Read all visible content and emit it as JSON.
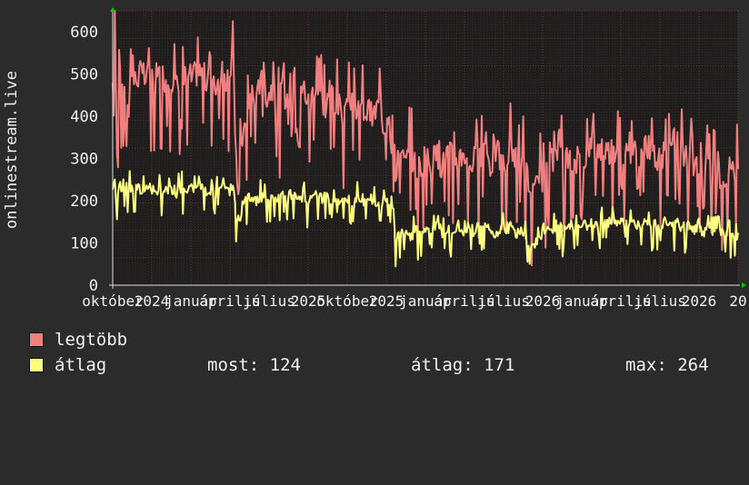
{
  "chart_data": {
    "type": "line",
    "ylabel": "onlinestream.live",
    "ylim": [
      0,
      650
    ],
    "y_ticks": [
      0,
      100,
      200,
      300,
      400,
      500,
      600
    ],
    "grid": true,
    "x_tick_labels": [
      "október",
      "2024",
      "január",
      "április",
      "július",
      "2025",
      "október",
      "2025",
      "január",
      "április",
      "július",
      "2026",
      "január",
      "április",
      "július",
      "2026",
      "20"
    ],
    "series": [
      {
        "name": "legtöbb",
        "color": "#f08080",
        "anchors": [
          [
            0,
            450
          ],
          [
            2,
            600
          ],
          [
            4,
            330
          ],
          [
            6,
            580
          ],
          [
            8,
            480
          ],
          [
            10,
            500
          ],
          [
            13,
            340
          ],
          [
            15,
            500
          ],
          [
            20,
            480
          ],
          [
            25,
            505
          ],
          [
            30,
            490
          ],
          [
            35,
            500
          ],
          [
            40,
            470
          ],
          [
            45,
            505
          ],
          [
            50,
            490
          ],
          [
            55,
            495
          ],
          [
            60,
            470
          ],
          [
            65,
            480
          ],
          [
            70,
            500
          ],
          [
            75,
            490
          ],
          [
            80,
            510
          ],
          [
            85,
            500
          ],
          [
            90,
            480
          ],
          [
            95,
            470
          ],
          [
            100,
            490
          ],
          [
            105,
            500
          ],
          [
            110,
            460
          ],
          [
            113,
            630
          ],
          [
            115,
            330
          ],
          [
            117,
            250
          ],
          [
            119,
            380
          ],
          [
            121,
            350
          ],
          [
            125,
            380
          ],
          [
            130,
            470
          ],
          [
            135,
            420
          ],
          [
            140,
            530
          ],
          [
            145,
            450
          ],
          [
            150,
            470
          ],
          [
            155,
            400
          ],
          [
            160,
            480
          ],
          [
            165,
            410
          ],
          [
            170,
            500
          ],
          [
            175,
            440
          ],
          [
            180,
            470
          ],
          [
            185,
            420
          ],
          [
            190,
            480
          ],
          [
            195,
            460
          ],
          [
            200,
            420
          ],
          [
            205,
            480
          ],
          [
            210,
            430
          ],
          [
            215,
            420
          ],
          [
            220,
            390
          ],
          [
            225,
            460
          ],
          [
            230,
            400
          ],
          [
            235,
            420
          ],
          [
            240,
            410
          ],
          [
            245,
            400
          ],
          [
            250,
            430
          ],
          [
            255,
            380
          ],
          [
            258,
            400
          ],
          [
            262,
            450
          ],
          [
            264,
            360
          ],
          [
            266,
            250
          ],
          [
            268,
            320
          ],
          [
            272,
            300
          ],
          [
            276,
            290
          ],
          [
            280,
            320
          ],
          [
            285,
            280
          ],
          [
            290,
            290
          ],
          [
            295,
            300
          ],
          [
            300,
            290
          ],
          [
            305,
            310
          ],
          [
            310,
            280
          ],
          [
            315,
            320
          ],
          [
            320,
            300
          ],
          [
            325,
            300
          ],
          [
            330,
            320
          ],
          [
            335,
            290
          ],
          [
            340,
            300
          ],
          [
            345,
            290
          ],
          [
            350,
            340
          ],
          [
            355,
            280
          ],
          [
            360,
            320
          ],
          [
            365,
            300
          ],
          [
            370,
            290
          ],
          [
            375,
            330
          ],
          [
            380,
            290
          ],
          [
            385,
            310
          ],
          [
            390,
            260
          ],
          [
            394,
            200
          ],
          [
            398,
            230
          ],
          [
            402,
            250
          ],
          [
            406,
            260
          ],
          [
            410,
            270
          ],
          [
            415,
            300
          ],
          [
            420,
            290
          ],
          [
            425,
            310
          ],
          [
            430,
            290
          ],
          [
            435,
            300
          ],
          [
            440,
            290
          ],
          [
            445,
            310
          ],
          [
            450,
            300
          ],
          [
            455,
            320
          ],
          [
            460,
            330
          ],
          [
            465,
            320
          ],
          [
            470,
            310
          ],
          [
            475,
            350
          ],
          [
            480,
            320
          ],
          [
            485,
            300
          ],
          [
            490,
            330
          ],
          [
            495,
            310
          ],
          [
            500,
            320
          ],
          [
            505,
            330
          ],
          [
            510,
            290
          ],
          [
            515,
            300
          ],
          [
            520,
            310
          ],
          [
            525,
            330
          ],
          [
            530,
            350
          ],
          [
            535,
            320
          ],
          [
            540,
            300
          ],
          [
            545,
            280
          ],
          [
            550,
            300
          ],
          [
            555,
            280
          ],
          [
            560,
            290
          ],
          [
            565,
            270
          ],
          [
            570,
            260
          ],
          [
            575,
            250
          ],
          [
            580,
            270
          ],
          [
            585,
            260
          ],
          [
            588,
            275
          ]
        ]
      },
      {
        "name": "átlag",
        "color": "#ffff80",
        "anchors": [
          [
            0,
            220
          ],
          [
            3,
            210
          ],
          [
            6,
            240
          ],
          [
            10,
            225
          ],
          [
            15,
            235
          ],
          [
            20,
            225
          ],
          [
            25,
            230
          ],
          [
            30,
            220
          ],
          [
            35,
            230
          ],
          [
            40,
            220
          ],
          [
            45,
            230
          ],
          [
            50,
            225
          ],
          [
            55,
            230
          ],
          [
            60,
            220
          ],
          [
            65,
            230
          ],
          [
            70,
            225
          ],
          [
            75,
            235
          ],
          [
            80,
            225
          ],
          [
            85,
            230
          ],
          [
            90,
            220
          ],
          [
            95,
            230
          ],
          [
            100,
            225
          ],
          [
            105,
            230
          ],
          [
            110,
            220
          ],
          [
            113,
            245
          ],
          [
            116,
            165
          ],
          [
            119,
            150
          ],
          [
            122,
            190
          ],
          [
            125,
            200
          ],
          [
            130,
            210
          ],
          [
            135,
            200
          ],
          [
            140,
            210
          ],
          [
            145,
            205
          ],
          [
            150,
            215
          ],
          [
            155,
            200
          ],
          [
            160,
            210
          ],
          [
            165,
            200
          ],
          [
            170,
            215
          ],
          [
            175,
            205
          ],
          [
            180,
            210
          ],
          [
            185,
            200
          ],
          [
            190,
            215
          ],
          [
            195,
            205
          ],
          [
            200,
            210
          ],
          [
            205,
            200
          ],
          [
            210,
            210
          ],
          [
            215,
            200
          ],
          [
            220,
            205
          ],
          [
            225,
            195
          ],
          [
            230,
            205
          ],
          [
            235,
            190
          ],
          [
            240,
            205
          ],
          [
            245,
            195
          ],
          [
            250,
            200
          ],
          [
            255,
            190
          ],
          [
            258,
            200
          ],
          [
            262,
            200
          ],
          [
            264,
            150
          ],
          [
            266,
            110
          ],
          [
            270,
            120
          ],
          [
            275,
            130
          ],
          [
            280,
            115
          ],
          [
            285,
            130
          ],
          [
            290,
            120
          ],
          [
            295,
            140
          ],
          [
            300,
            125
          ],
          [
            305,
            145
          ],
          [
            310,
            125
          ],
          [
            315,
            140
          ],
          [
            320,
            125
          ],
          [
            325,
            145
          ],
          [
            330,
            125
          ],
          [
            335,
            140
          ],
          [
            340,
            125
          ],
          [
            345,
            145
          ],
          [
            350,
            125
          ],
          [
            355,
            135
          ],
          [
            360,
            120
          ],
          [
            365,
            135
          ],
          [
            370,
            125
          ],
          [
            375,
            140
          ],
          [
            380,
            120
          ],
          [
            385,
            130
          ],
          [
            390,
            110
          ],
          [
            394,
            90
          ],
          [
            398,
            100
          ],
          [
            402,
            115
          ],
          [
            406,
            120
          ],
          [
            410,
            130
          ],
          [
            415,
            130
          ],
          [
            420,
            140
          ],
          [
            425,
            130
          ],
          [
            430,
            145
          ],
          [
            435,
            130
          ],
          [
            440,
            150
          ],
          [
            445,
            140
          ],
          [
            450,
            155
          ],
          [
            455,
            145
          ],
          [
            460,
            160
          ],
          [
            465,
            150
          ],
          [
            470,
            155
          ],
          [
            475,
            145
          ],
          [
            480,
            150
          ],
          [
            485,
            145
          ],
          [
            490,
            150
          ],
          [
            495,
            140
          ],
          [
            500,
            155
          ],
          [
            505,
            140
          ],
          [
            510,
            150
          ],
          [
            515,
            140
          ],
          [
            520,
            155
          ],
          [
            525,
            140
          ],
          [
            530,
            150
          ],
          [
            535,
            135
          ],
          [
            540,
            145
          ],
          [
            545,
            130
          ],
          [
            550,
            140
          ],
          [
            555,
            125
          ],
          [
            560,
            135
          ],
          [
            565,
            120
          ],
          [
            570,
            130
          ],
          [
            575,
            115
          ],
          [
            580,
            125
          ],
          [
            585,
            115
          ],
          [
            588,
            124
          ]
        ]
      }
    ]
  },
  "legend": {
    "items": [
      {
        "label": "legtöbb",
        "color": "#f08080"
      },
      {
        "label": "átlag",
        "color": "#ffff80"
      }
    ],
    "stats": {
      "now": "most: 124",
      "avg": "átlag: 171",
      "max": "max: 264"
    }
  },
  "colors": {
    "background": "#2b2b2b",
    "plot_background": "#1e1e1e",
    "grid": "#7a3a3a",
    "axis": "#e0e0e0"
  }
}
